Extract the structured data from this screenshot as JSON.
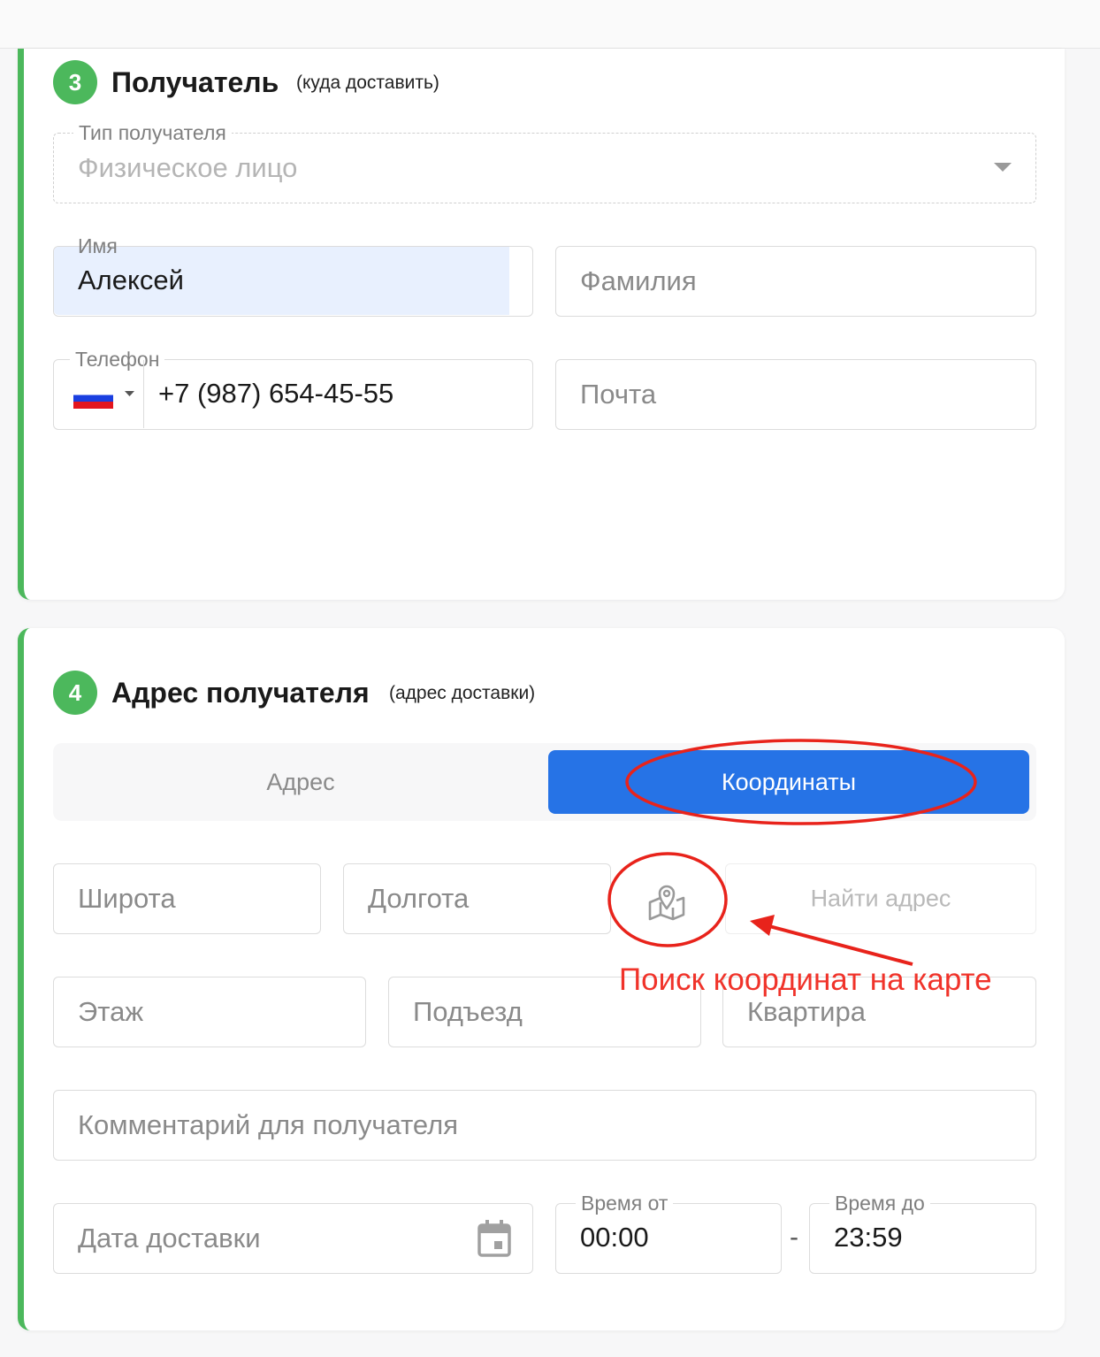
{
  "recipient": {
    "step": "3",
    "title": "Получатель",
    "subtitle": "(куда доставить)",
    "type_label": "Тип получателя",
    "type_value": "Физическое лицо",
    "first_name_label": "Имя",
    "first_name_value": "Алексей",
    "last_name_placeholder": "Фамилия",
    "phone_label": "Телефон",
    "phone_value": "+7 (987) 654-45-55",
    "email_placeholder": "Почта"
  },
  "address": {
    "step": "4",
    "title": "Адрес получателя",
    "subtitle": "(адрес доставки)",
    "tabs": [
      {
        "label": "Адрес",
        "active": false
      },
      {
        "label": "Координаты",
        "active": true
      }
    ],
    "latitude_placeholder": "Широта",
    "longitude_placeholder": "Долгота",
    "find_address_label": "Найти адрес",
    "map_icon": "map-pin-icon",
    "floor_placeholder": "Этаж",
    "entrance_placeholder": "Подъезд",
    "apartment_placeholder": "Квартира",
    "comment_placeholder": "Комментарий для получателя",
    "date_placeholder": "Дата доставки",
    "calendar_icon": "calendar-icon",
    "time_from_label": "Время от",
    "time_from_value": "00:00",
    "time_separator": "-",
    "time_to_label": "Время до",
    "time_to_value": "23:59"
  },
  "annotation": {
    "text": "Поиск координат на карте",
    "color": "#f0332a"
  },
  "colors": {
    "accent_green": "#4cb85c",
    "accent_blue": "#2673e6",
    "autofill_bg": "#e8f0fe"
  }
}
